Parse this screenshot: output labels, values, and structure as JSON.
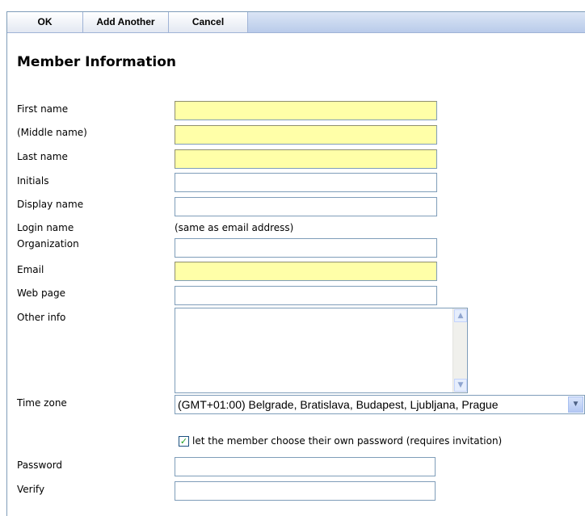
{
  "toolbar": {
    "ok_label": "OK",
    "add_another_label": "Add Another",
    "cancel_label": "Cancel"
  },
  "page_title": "Member Information",
  "fields": {
    "first_name": {
      "label": "First name",
      "value": ""
    },
    "middle_name": {
      "label": "(Middle name)",
      "value": ""
    },
    "last_name": {
      "label": "Last name",
      "value": ""
    },
    "initials": {
      "label": "Initials",
      "value": ""
    },
    "display_name": {
      "label": "Display name",
      "value": ""
    },
    "login_name": {
      "label": "Login name",
      "value": "(same as email address)"
    },
    "organization": {
      "label": "Organization",
      "value": ""
    },
    "email": {
      "label": "Email",
      "value": ""
    },
    "web_page": {
      "label": "Web page",
      "value": ""
    },
    "other_info": {
      "label": "Other info",
      "value": ""
    },
    "time_zone": {
      "label": "Time zone",
      "selected": "(GMT+01:00) Belgrade, Bratislava, Budapest, Ljubljana, Prague"
    },
    "choose_password": {
      "label": "let the member choose their own password (requires invitation)",
      "checked": true
    },
    "password": {
      "label": "Password",
      "value": ""
    },
    "verify": {
      "label": "Verify",
      "value": ""
    }
  },
  "icons": {
    "scroll_up": "▲",
    "scroll_down": "▼",
    "dropdown": "▼",
    "check": "✓"
  },
  "colors": {
    "required_field": "#ffffa8",
    "toolbar_bg": "#b9cbea",
    "border": "#7f9db9"
  }
}
